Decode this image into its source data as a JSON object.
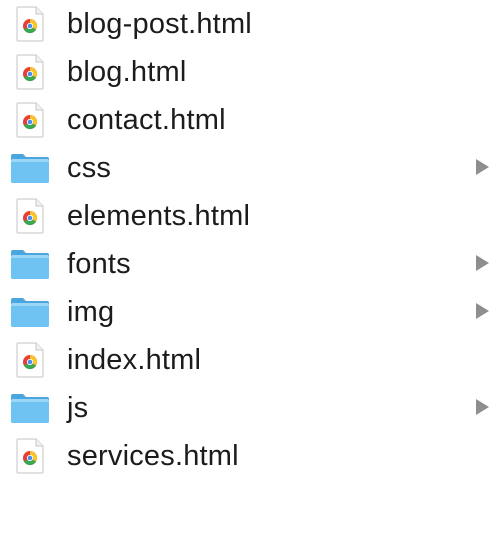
{
  "items": [
    {
      "name": "blog-post.html",
      "kind": "html",
      "icon": "chrome-html-file-icon"
    },
    {
      "name": "blog.html",
      "kind": "html",
      "icon": "chrome-html-file-icon"
    },
    {
      "name": "contact.html",
      "kind": "html",
      "icon": "chrome-html-file-icon"
    },
    {
      "name": "css",
      "kind": "folder",
      "icon": "folder-icon"
    },
    {
      "name": "elements.html",
      "kind": "html",
      "icon": "chrome-html-file-icon"
    },
    {
      "name": "fonts",
      "kind": "folder",
      "icon": "folder-icon"
    },
    {
      "name": "img",
      "kind": "folder",
      "icon": "folder-icon"
    },
    {
      "name": "index.html",
      "kind": "html",
      "icon": "chrome-html-file-icon"
    },
    {
      "name": "js",
      "kind": "folder",
      "icon": "folder-icon"
    },
    {
      "name": "services.html",
      "kind": "html",
      "icon": "chrome-html-file-icon"
    }
  ],
  "colors": {
    "folder": "#6ec3f2",
    "folder_dark": "#4aa6dd",
    "disclosure": "#8e8e8e",
    "text": "#1c1c1c"
  }
}
